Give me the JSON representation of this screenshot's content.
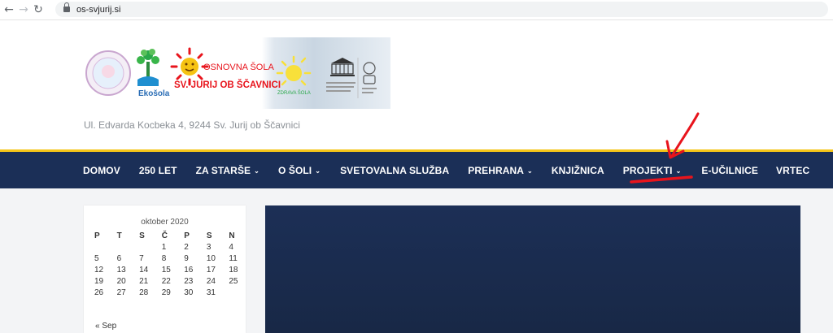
{
  "browser": {
    "url": "os-svjurij.si",
    "back_icon": "←",
    "forward_icon": "→",
    "reload_icon": "↻"
  },
  "header": {
    "tagline": "Ul. Edvarda Kocbeka 4, 9244 Sv. Jurij ob Ščavnici",
    "banner": {
      "ekosola_label": "Ekošola",
      "school_line1": "OSNOVNA ŠOLA",
      "school_line2": "SV. JURIJ OB ŠČAVNICI",
      "zdrava_sola": "ZDRAVA ŠOLA",
      "unesco_label": "UNESCO"
    }
  },
  "nav": {
    "items": [
      {
        "label": "DOMOV",
        "has_dropdown": false
      },
      {
        "label": "250 LET",
        "has_dropdown": false
      },
      {
        "label": "ZA STARŠE",
        "has_dropdown": true
      },
      {
        "label": "O ŠOLI",
        "has_dropdown": true
      },
      {
        "label": "SVETOVALNA SLUŽBA",
        "has_dropdown": false
      },
      {
        "label": "PREHRANA",
        "has_dropdown": true
      },
      {
        "label": "KNJIŽNICA",
        "has_dropdown": false
      },
      {
        "label": "PROJEKTI",
        "has_dropdown": true
      },
      {
        "label": "E-UČILNICE",
        "has_dropdown": false
      },
      {
        "label": "VRTEC",
        "has_dropdown": false
      }
    ],
    "dropdown_icon": "⌄"
  },
  "calendar": {
    "month": "oktober 2020",
    "weekdays": [
      "P",
      "T",
      "S",
      "Č",
      "P",
      "S",
      "N"
    ],
    "weeks": [
      [
        "",
        "",
        "",
        "1",
        "2",
        "3",
        "4"
      ],
      [
        "5",
        "6",
        "7",
        "8",
        "9",
        "10",
        "11"
      ],
      [
        "12",
        "13",
        "14",
        "15",
        "16",
        "17",
        "18"
      ],
      [
        "19",
        "20",
        "21",
        "22",
        "23",
        "24",
        "25"
      ],
      [
        "26",
        "27",
        "28",
        "29",
        "30",
        "31",
        ""
      ]
    ],
    "prev_link": "« Sep"
  },
  "colors": {
    "navbar": "#1b2f57",
    "accent_line": "#f5c518",
    "annotation": "#e8141c"
  }
}
